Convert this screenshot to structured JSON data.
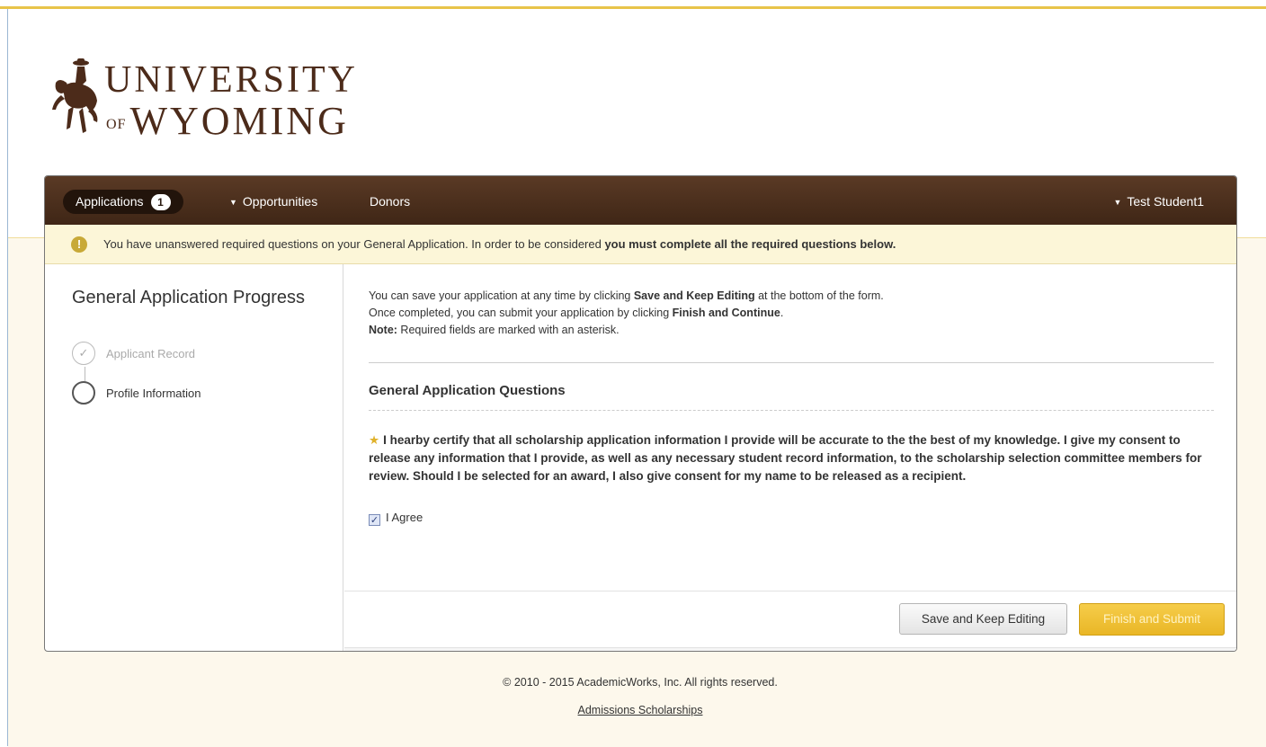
{
  "logo": {
    "line1": "UNIVERSITY",
    "of": "OF",
    "line2": "WYOMING"
  },
  "nav": {
    "applications_label": "Applications",
    "applications_count": "1",
    "opportunities_label": "Opportunities",
    "donors_label": "Donors",
    "user_label": "Test Student1"
  },
  "alert": {
    "text": "You have unanswered required questions on your General Application. In order to be considered ",
    "bold": "you must complete all the required questions below."
  },
  "sidebar": {
    "title": "General Application Progress",
    "steps": [
      {
        "label": "Applicant Record",
        "status": "complete"
      },
      {
        "label": "Profile Information",
        "status": "current"
      }
    ]
  },
  "intro": {
    "line1_pre": "You can save your application at any time by clicking ",
    "line1_bold": "Save and Keep Editing",
    "line1_post": " at the bottom of the form.",
    "line2_pre": "Once completed, you can submit your application by clicking ",
    "line2_bold": "Finish and Continue",
    "line2_post": ".",
    "note_label": "Note:",
    "note_text": " Required fields are marked with an asterisk."
  },
  "section_title": "General Application Questions",
  "question": {
    "text": "I hearby certify that all scholarship application information I provide will be accurate to the the best of my knowledge. I give my consent to release any information that I provide, as well as any necessary student record information, to the scholarship selection committee members for review. Should I be selected for an award, I also give consent for my name to be released as a recipient.",
    "checkbox_label": "I Agree",
    "checked": true
  },
  "buttons": {
    "save": "Save and Keep Editing",
    "finish": "Finish and Submit"
  },
  "footer": {
    "copyright": "© 2010 - 2015 AcademicWorks, Inc. All rights reserved.",
    "link": "Admissions Scholarships"
  },
  "colors": {
    "nav_brown": "#4a2e1c",
    "accent_gold": "#e9b626",
    "alert_bg": "#fcf6d8"
  }
}
